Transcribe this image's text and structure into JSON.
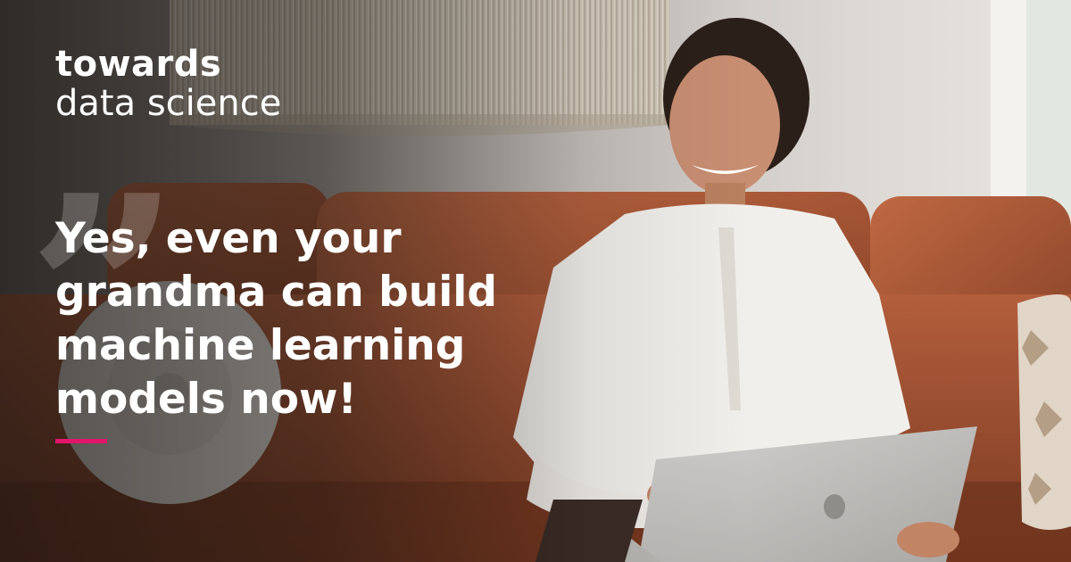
{
  "brand": {
    "line1": "towards",
    "line2": "data science"
  },
  "decoration": {
    "quote_mark": "”"
  },
  "headline": {
    "lines": [
      "Yes, even your",
      "grandma can build",
      "machine learning",
      "models now!"
    ]
  },
  "colors": {
    "accent": "#e2156b",
    "text": "#ffffff"
  }
}
